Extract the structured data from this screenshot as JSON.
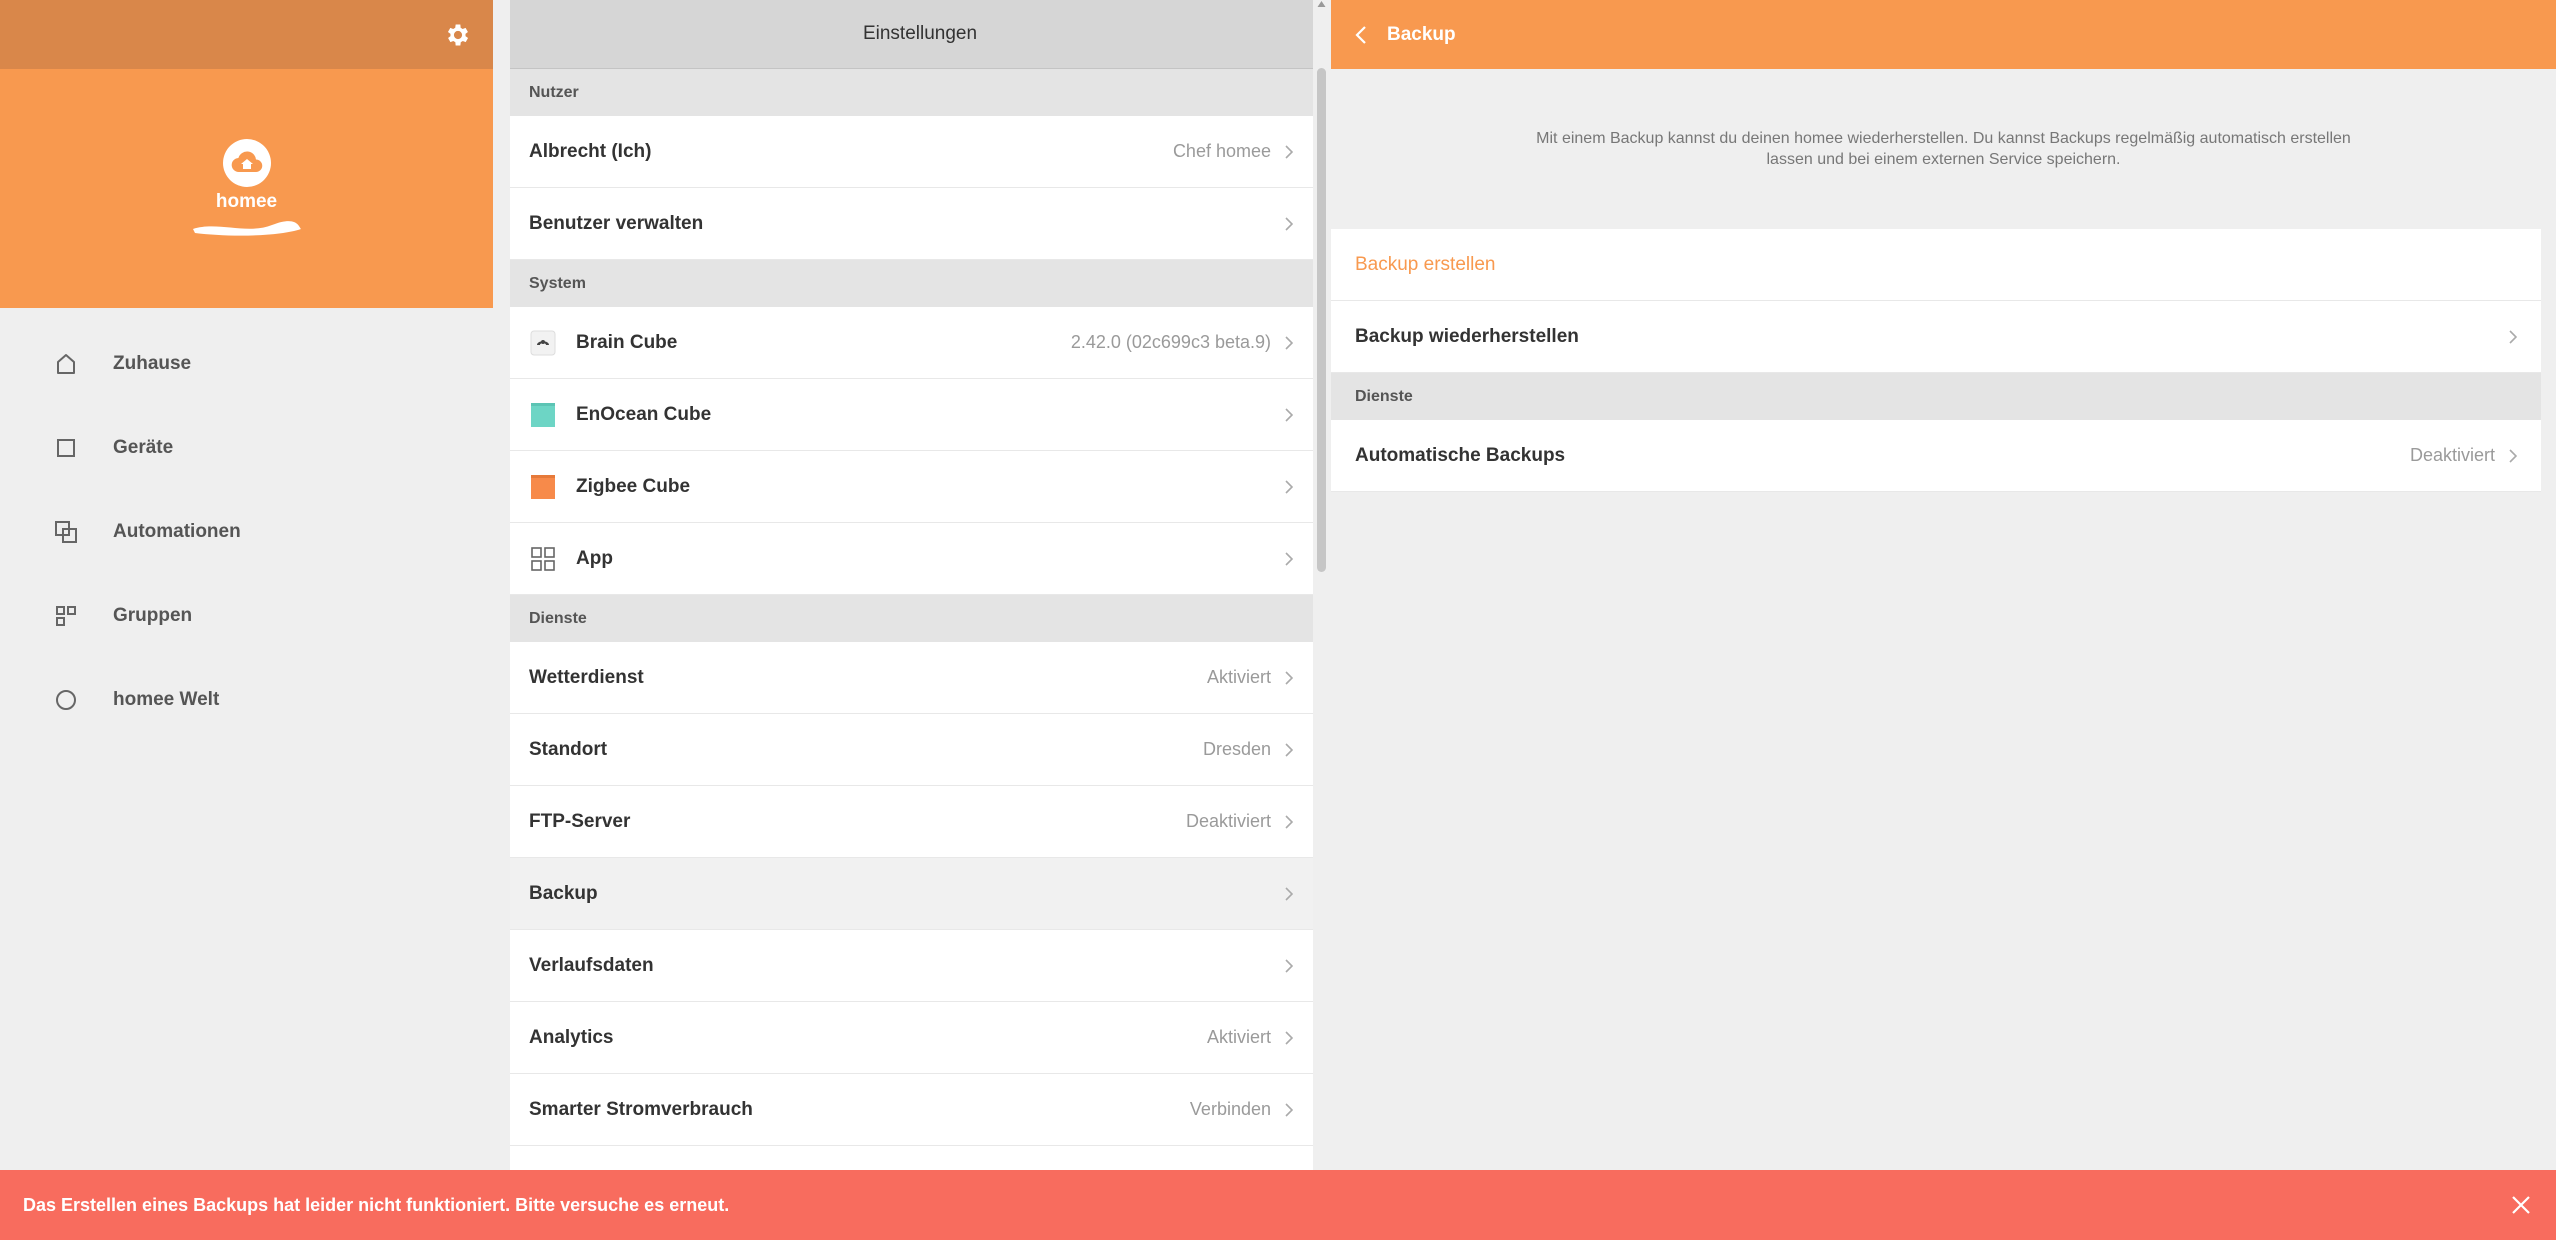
{
  "sidebar": {
    "profile_name": "homee",
    "nav": [
      {
        "label": "Zuhause",
        "icon": "home-icon"
      },
      {
        "label": "Geräte",
        "icon": "device-square-icon"
      },
      {
        "label": "Automationen",
        "icon": "automation-icon"
      },
      {
        "label": "Gruppen",
        "icon": "groups-icon"
      },
      {
        "label": "homee Welt",
        "icon": "world-circle-icon"
      }
    ]
  },
  "settings": {
    "title": "Einstellungen",
    "sections": {
      "nutzer": "Nutzer",
      "system": "System",
      "dienste": "Dienste"
    },
    "nutzer_rows": [
      {
        "label": "Albrecht (Ich)",
        "value": "Chef homee"
      },
      {
        "label": "Benutzer verwalten",
        "value": ""
      }
    ],
    "system_rows": [
      {
        "label": "Brain Cube",
        "value": "2.42.0 (02c699c3 beta.9)",
        "icon": "brain-cube-icon"
      },
      {
        "label": "EnOcean Cube",
        "value": "",
        "icon": "enocean-cube-icon"
      },
      {
        "label": "Zigbee Cube",
        "value": "",
        "icon": "zigbee-cube-icon"
      },
      {
        "label": "App",
        "value": "",
        "icon": "app-grid-icon"
      }
    ],
    "dienste_rows": [
      {
        "label": "Wetterdienst",
        "value": "Aktiviert"
      },
      {
        "label": "Standort",
        "value": "Dresden"
      },
      {
        "label": "FTP-Server",
        "value": "Deaktiviert"
      },
      {
        "label": "Backup",
        "value": ""
      },
      {
        "label": "Verlaufsdaten",
        "value": ""
      },
      {
        "label": "Analytics",
        "value": "Aktiviert"
      },
      {
        "label": "Smarter Stromverbrauch",
        "value": "Verbinden"
      }
    ]
  },
  "backup": {
    "title": "Backup",
    "description": "Mit einem Backup kannst du deinen homee wiederherstellen. Du kannst Backups regelmäßig automatisch erstellen lassen und bei einem externen Service speichern.",
    "create_label": "Backup erstellen",
    "restore_label": "Backup wiederherstellen",
    "services_header": "Dienste",
    "auto_label": "Automatische Backups",
    "auto_value": "Deaktiviert"
  },
  "error": {
    "message": "Das Erstellen eines Backups hat leider nicht funktioniert. Bitte versuche es erneut."
  },
  "colors": {
    "accent": "#f8994f",
    "accent_dark": "#d9874a",
    "error": "#f86c5e",
    "enocean": "#6dd5c5",
    "zigbee": "#f78a4a"
  }
}
